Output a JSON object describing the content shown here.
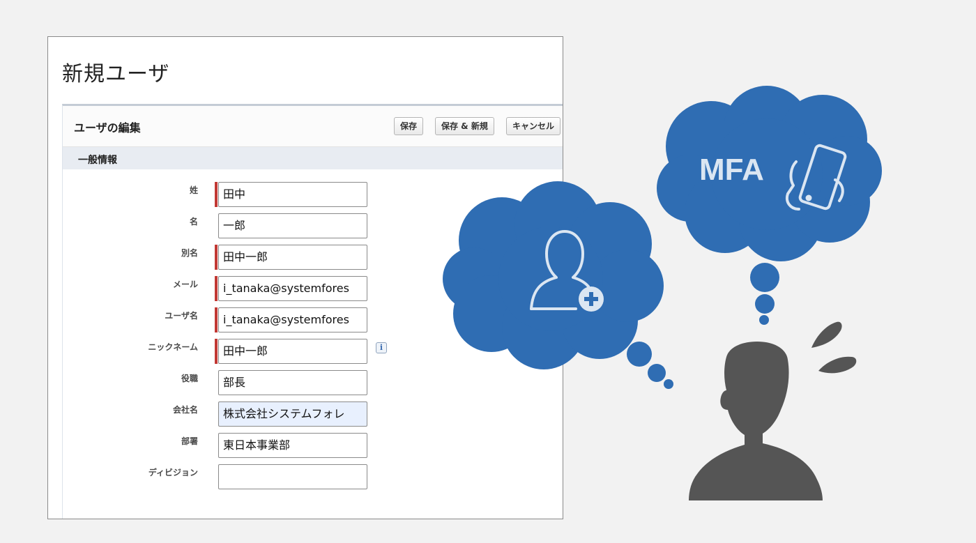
{
  "page": {
    "title": "新規ユーザ"
  },
  "edit_panel": {
    "title": "ユーザの編集",
    "buttons": {
      "save": "保存",
      "save_new": "保存 & 新規",
      "cancel": "キャンセル"
    },
    "section_title": "一般情報"
  },
  "fields": [
    {
      "label": "姓",
      "value": "田中",
      "required": true
    },
    {
      "label": "名",
      "value": "一郎",
      "required": false
    },
    {
      "label": "別名",
      "value": "田中一郎",
      "required": true
    },
    {
      "label": "メール",
      "value": "i_tanaka@systemfores",
      "required": true
    },
    {
      "label": "ユーザ名",
      "value": "i_tanaka@systemfores",
      "required": true
    },
    {
      "label": "ニックネーム",
      "value": "田中一郎",
      "required": true,
      "info_icon": "i"
    },
    {
      "label": "役職",
      "value": "部長",
      "required": false
    },
    {
      "label": "会社名",
      "value": "株式会社システムフォレ",
      "required": false,
      "autofilled": true
    },
    {
      "label": "部署",
      "value": "東日本事業部",
      "required": false
    },
    {
      "label": "ディビジョン",
      "value": "",
      "required": false
    }
  ],
  "illustration": {
    "mfa_text": "MFA",
    "colors": {
      "cloud": "#2f6db3",
      "person": "#555555",
      "required": "#c23934"
    },
    "icons": [
      "add-user-icon",
      "smartphone-hand-icon",
      "person-silhouette-icon",
      "sweat-drop-icon"
    ]
  }
}
